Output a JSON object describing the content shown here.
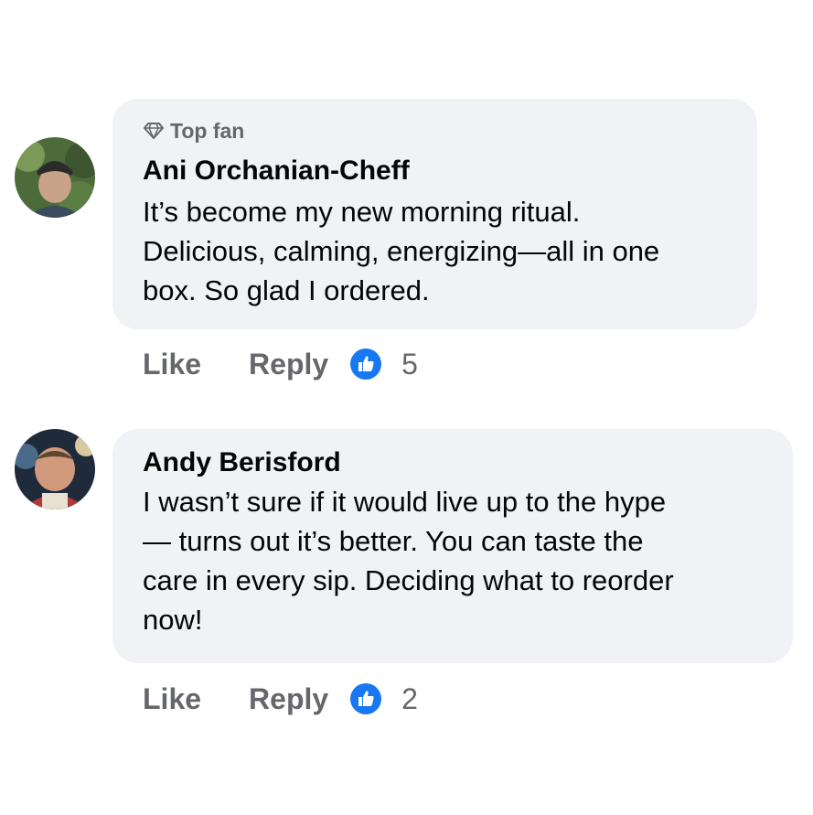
{
  "comments": [
    {
      "badge": "Top fan",
      "badge_icon": "diamond-icon",
      "author": "Ani Orchanian-Cheff",
      "text": "It’s become my new morning ritual.\nDelicious, calming, energizing—all in one\nbox. So glad I ordered.",
      "like_label": "Like",
      "reply_label": "Reply",
      "reaction_icon": "thumbs-up-icon",
      "reaction_count": "5"
    },
    {
      "author": "Andy Berisford",
      "text": "I wasn’t sure if it would live up to the hype\n— turns out it’s better. You can taste the\ncare in every sip. Deciding what to reorder\nnow!",
      "like_label": "Like",
      "reply_label": "Reply",
      "reaction_icon": "thumbs-up-icon",
      "reaction_count": "2"
    }
  ],
  "colors": {
    "bubble": "#f0f2f5",
    "text": "#050505",
    "secondary": "#65676b",
    "like_blue": "#1877f2"
  }
}
